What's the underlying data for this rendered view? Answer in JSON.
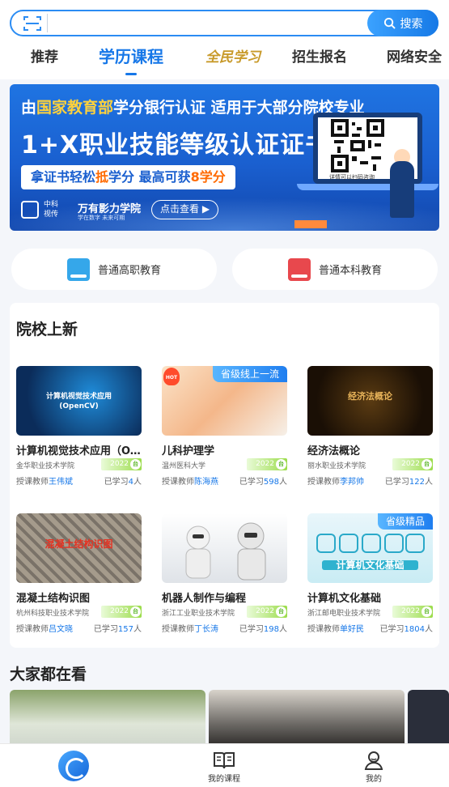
{
  "search": {
    "button_label": "搜索",
    "placeholder": ""
  },
  "tabs": [
    {
      "label": "推荐"
    },
    {
      "label": "学历课程"
    },
    {
      "label": "全民学习"
    },
    {
      "label": "招生报名"
    },
    {
      "label": "网络安全"
    }
  ],
  "banner": {
    "line1_prefix": "由",
    "line1_highlight": "国家教育部",
    "line1_suffix": "学分银行认证  适用于大部分院校专业",
    "line2": "1+X职业技能等级认证证书",
    "pill_prefix": "拿证书轻松",
    "pill_hl1": "抵",
    "pill_mid": "学分 最高可获",
    "pill_hl2": "8学分",
    "logo_text": "中科视传",
    "brand": "万有影力学院",
    "brand_sub": "学在数字 未来可期",
    "cta": "点击查看 ▶",
    "qr_caption": "详情可以扫码咨询"
  },
  "edu_buttons": [
    {
      "label": "普通高职教育",
      "icon": "vocational-book-icon"
    },
    {
      "label": "普通本科教育",
      "icon": "undergrad-book-icon"
    }
  ],
  "new_courses": {
    "title": "院校上新",
    "items": [
      {
        "name": "计算机视觉技术应用（O...",
        "school": "金华职业技术学院",
        "year": "2022",
        "teacher_prefix": "授课教师",
        "teacher": "王伟斌",
        "count_prefix": "已学习",
        "count": "4",
        "count_suffix": "人",
        "thumb_title": "计算机视觉技术应用\n(OpenCV)",
        "badge": ""
      },
      {
        "name": "儿科护理学",
        "school": "温州医科大学",
        "year": "2022",
        "teacher_prefix": "授课教师",
        "teacher": "陈海燕",
        "count_prefix": "已学习",
        "count": "598",
        "count_suffix": "人",
        "thumb_title": "",
        "badge": "省级线上一流",
        "hot": "HOT"
      },
      {
        "name": "经济法概论",
        "school": "丽水职业技术学院",
        "year": "2022",
        "teacher_prefix": "授课教师",
        "teacher": "李邦帅",
        "count_prefix": "已学习",
        "count": "122",
        "count_suffix": "人",
        "thumb_title": "经济法概论",
        "badge": ""
      },
      {
        "name": "混凝土结构识图",
        "school": "杭州科技职业技术学院",
        "year": "2022",
        "teacher_prefix": "授课教师",
        "teacher": "吕文晓",
        "count_prefix": "已学习",
        "count": "157",
        "count_suffix": "人",
        "thumb_title": "混凝土结构识图",
        "badge": ""
      },
      {
        "name": "机器人制作与编程",
        "school": "浙江工业职业技术学院",
        "year": "2022",
        "teacher_prefix": "授课教师",
        "teacher": "丁长涛",
        "count_prefix": "已学习",
        "count": "198",
        "count_suffix": "人",
        "thumb_title": "",
        "badge": ""
      },
      {
        "name": "计算机文化基础",
        "school": "浙江邮电职业技术学院",
        "year": "2022",
        "teacher_prefix": "授课教师",
        "teacher": "单好民",
        "count_prefix": "已学习",
        "count": "1804",
        "count_suffix": "人",
        "thumb_title": "计算机文化基础",
        "badge": "省级精品"
      }
    ],
    "year_dot": "台"
  },
  "watching": {
    "title": "大家都在看"
  },
  "bottom_nav": [
    {
      "label": "",
      "icon": "home-logo-icon"
    },
    {
      "label": "我的课程",
      "icon": "book-icon"
    },
    {
      "label": "我的",
      "icon": "user-icon"
    }
  ],
  "colors": {
    "primary": "#1677e8",
    "accent_orange": "#ff6a00",
    "year_green": "#9bdc4a"
  }
}
